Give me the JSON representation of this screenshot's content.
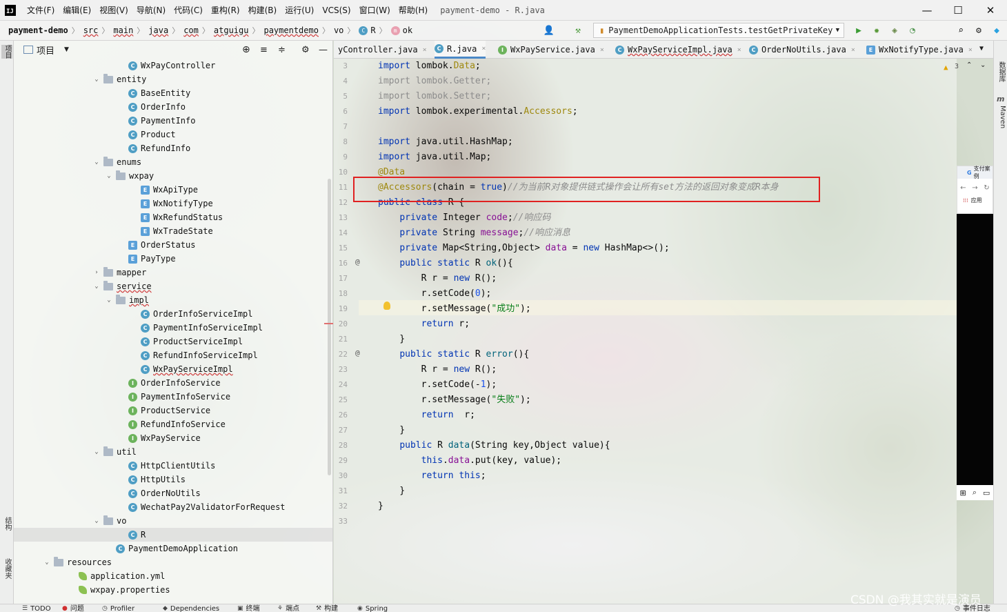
{
  "app": {
    "logo_text": "IJ",
    "window_title": "payment-demo - R.java",
    "menus": [
      "文件(F)",
      "编辑(E)",
      "视图(V)",
      "导航(N)",
      "代码(C)",
      "重构(R)",
      "构建(B)",
      "运行(U)",
      "VCS(S)",
      "窗口(W)",
      "帮助(H)"
    ],
    "controls": {
      "minimize": "—",
      "maximize": "☐",
      "close": "✕"
    }
  },
  "breadcrumb": [
    {
      "label": "payment-demo",
      "icon": ""
    },
    {
      "label": "src",
      "icon": ""
    },
    {
      "label": "main",
      "icon": ""
    },
    {
      "label": "java",
      "icon": ""
    },
    {
      "label": "com",
      "icon": ""
    },
    {
      "label": "atguigu",
      "icon": ""
    },
    {
      "label": "paymentdemo",
      "icon": ""
    },
    {
      "label": "vo",
      "icon": ""
    },
    {
      "label": "R",
      "icon": "C"
    },
    {
      "label": "ok",
      "icon": "m"
    }
  ],
  "run_config": "PaymentDemoApplicationTests.testGetPrivateKey",
  "left_stripe": {
    "project": "项目",
    "structure": "结构",
    "favorites": "收藏夹"
  },
  "right_stripe": {
    "database": "数据库",
    "maven": "Maven"
  },
  "project_panel": {
    "title": "项目"
  },
  "tree": [
    {
      "label": "WxPayController",
      "icon": "C",
      "arrow": ""
    },
    {
      "label": "entity",
      "icon": "folder",
      "arrow": "v"
    },
    {
      "label": "BaseEntity",
      "icon": "C",
      "arrow": ""
    },
    {
      "label": "OrderInfo",
      "icon": "C",
      "arrow": ""
    },
    {
      "label": "PaymentInfo",
      "icon": "C",
      "arrow": ""
    },
    {
      "label": "Product",
      "icon": "C",
      "arrow": ""
    },
    {
      "label": "RefundInfo",
      "icon": "C",
      "arrow": ""
    },
    {
      "label": "enums",
      "icon": "folder",
      "arrow": "v"
    },
    {
      "label": "wxpay",
      "icon": "folder",
      "arrow": "v"
    },
    {
      "label": "WxApiType",
      "icon": "E",
      "arrow": ""
    },
    {
      "label": "WxNotifyType",
      "icon": "E",
      "arrow": ""
    },
    {
      "label": "WxRefundStatus",
      "icon": "E",
      "arrow": ""
    },
    {
      "label": "WxTradeState",
      "icon": "E",
      "arrow": ""
    },
    {
      "label": "OrderStatus",
      "icon": "E",
      "arrow": ""
    },
    {
      "label": "PayType",
      "icon": "E",
      "arrow": ""
    },
    {
      "label": "mapper",
      "icon": "folder",
      "arrow": ">"
    },
    {
      "label": "service",
      "icon": "folder",
      "arrow": "v"
    },
    {
      "label": "impl",
      "icon": "folder",
      "arrow": "v"
    },
    {
      "label": "OrderInfoServiceImpl",
      "icon": "C",
      "arrow": ""
    },
    {
      "label": "PaymentInfoServiceImpl",
      "icon": "C",
      "arrow": ""
    },
    {
      "label": "ProductServiceImpl",
      "icon": "C",
      "arrow": ""
    },
    {
      "label": "RefundInfoServiceImpl",
      "icon": "C",
      "arrow": ""
    },
    {
      "label": "WxPayServiceImpl",
      "icon": "C",
      "arrow": ""
    },
    {
      "label": "OrderInfoService",
      "icon": "I",
      "arrow": ""
    },
    {
      "label": "PaymentInfoService",
      "icon": "I",
      "arrow": ""
    },
    {
      "label": "ProductService",
      "icon": "I",
      "arrow": ""
    },
    {
      "label": "RefundInfoService",
      "icon": "I",
      "arrow": ""
    },
    {
      "label": "WxPayService",
      "icon": "I",
      "arrow": ""
    },
    {
      "label": "util",
      "icon": "folder",
      "arrow": "v"
    },
    {
      "label": "HttpClientUtils",
      "icon": "C",
      "arrow": ""
    },
    {
      "label": "HttpUtils",
      "icon": "C",
      "arrow": ""
    },
    {
      "label": "OrderNoUtils",
      "icon": "C",
      "arrow": ""
    },
    {
      "label": "WechatPay2ValidatorForRequest",
      "icon": "C",
      "arrow": ""
    },
    {
      "label": "vo",
      "icon": "folder",
      "arrow": "v"
    },
    {
      "label": "R",
      "icon": "C",
      "arrow": ""
    },
    {
      "label": "PaymentDemoApplication",
      "icon": "C",
      "arrow": ""
    },
    {
      "label": "resources",
      "icon": "folder",
      "arrow": "v"
    },
    {
      "label": "application.yml",
      "icon": "leaf",
      "arrow": ""
    },
    {
      "label": "wxpay.properties",
      "icon": "leaf",
      "arrow": ""
    }
  ],
  "editor_tabs": [
    {
      "label": "yController.java",
      "icon": ""
    },
    {
      "label": "R.java",
      "icon": "C"
    },
    {
      "label": "WxPayService.java",
      "icon": "I"
    },
    {
      "label": "WxPayServiceImpl.java",
      "icon": "C"
    },
    {
      "label": "OrderNoUtils.java",
      "icon": "C"
    },
    {
      "label": "WxNotifyType.java",
      "icon": "E"
    }
  ],
  "warnings_count": "3",
  "code": {
    "line_numbers": [
      "3",
      "4",
      "5",
      "6",
      "7",
      "8",
      "9",
      "10",
      "11",
      "12",
      "13",
      "14",
      "15",
      "16",
      "17",
      "18",
      "19",
      "20",
      "21",
      "22",
      "23",
      "24",
      "25",
      "26",
      "27",
      "28",
      "29",
      "30",
      "31",
      "32",
      "33"
    ],
    "lines": [
      [
        {
          "t": "kw",
          "v": "import "
        },
        {
          "t": "plain",
          "v": "lombok."
        },
        {
          "t": "ann",
          "v": "Data"
        },
        {
          "t": "plain",
          "v": ";"
        }
      ],
      [
        {
          "t": "gray",
          "v": "import lombok.Getter;"
        }
      ],
      [
        {
          "t": "gray",
          "v": "import lombok.Setter;"
        }
      ],
      [
        {
          "t": "kw",
          "v": "import "
        },
        {
          "t": "plain",
          "v": "lombok.experimental."
        },
        {
          "t": "ann",
          "v": "Accessors"
        },
        {
          "t": "plain",
          "v": ";"
        }
      ],
      [],
      [
        {
          "t": "kw",
          "v": "import "
        },
        {
          "t": "plain",
          "v": "java.util.HashMap;"
        }
      ],
      [
        {
          "t": "kw",
          "v": "import "
        },
        {
          "t": "plain",
          "v": "java.util.Map;"
        }
      ],
      [
        {
          "t": "ann",
          "v": "@Data"
        }
      ],
      [
        {
          "t": "ann",
          "v": "@Accessors"
        },
        {
          "t": "plain",
          "v": "(chain = "
        },
        {
          "t": "kw",
          "v": "true"
        },
        {
          "t": "plain",
          "v": ")"
        },
        {
          "t": "cmt",
          "v": "//为当前R对象提供链式操作会让所有set方法的返回对象变成R本身"
        }
      ],
      [
        {
          "t": "kw",
          "v": "public class "
        },
        {
          "t": "plain",
          "v": "R {"
        }
      ],
      [
        {
          "t": "plain",
          "v": "    "
        },
        {
          "t": "kw",
          "v": "private "
        },
        {
          "t": "plain",
          "v": "Integer "
        },
        {
          "t": "field",
          "v": "code"
        },
        {
          "t": "plain",
          "v": ";"
        },
        {
          "t": "cmt",
          "v": "//响应码"
        }
      ],
      [
        {
          "t": "plain",
          "v": "    "
        },
        {
          "t": "kw",
          "v": "private "
        },
        {
          "t": "plain",
          "v": "String "
        },
        {
          "t": "field",
          "v": "message"
        },
        {
          "t": "plain",
          "v": ";"
        },
        {
          "t": "cmt",
          "v": "//响应消息"
        }
      ],
      [
        {
          "t": "plain",
          "v": "    "
        },
        {
          "t": "kw",
          "v": "private "
        },
        {
          "t": "plain",
          "v": "Map<String,Object> "
        },
        {
          "t": "field",
          "v": "data"
        },
        {
          "t": "plain",
          "v": " = "
        },
        {
          "t": "kw",
          "v": "new "
        },
        {
          "t": "plain",
          "v": "HashMap<>();"
        }
      ],
      [
        {
          "t": "plain",
          "v": "    "
        },
        {
          "t": "kw",
          "v": "public static "
        },
        {
          "t": "plain",
          "v": "R "
        },
        {
          "t": "fn",
          "v": "ok"
        },
        {
          "t": "plain",
          "v": "(){"
        }
      ],
      [
        {
          "t": "plain",
          "v": "        R r = "
        },
        {
          "t": "kw",
          "v": "new "
        },
        {
          "t": "plain",
          "v": "R();"
        }
      ],
      [
        {
          "t": "plain",
          "v": "        r.setCode("
        },
        {
          "t": "num",
          "v": "0"
        },
        {
          "t": "plain",
          "v": ");"
        }
      ],
      [
        {
          "t": "plain",
          "v": "        r.setMessage("
        },
        {
          "t": "str",
          "v": "\"成功\""
        },
        {
          "t": "plain",
          "v": ");"
        }
      ],
      [
        {
          "t": "plain",
          "v": "        "
        },
        {
          "t": "kw",
          "v": "return "
        },
        {
          "t": "plain",
          "v": "r;"
        }
      ],
      [
        {
          "t": "plain",
          "v": "    }"
        }
      ],
      [
        {
          "t": "plain",
          "v": "    "
        },
        {
          "t": "kw",
          "v": "public static "
        },
        {
          "t": "plain",
          "v": "R "
        },
        {
          "t": "fn",
          "v": "error"
        },
        {
          "t": "plain",
          "v": "(){"
        }
      ],
      [
        {
          "t": "plain",
          "v": "        R r = "
        },
        {
          "t": "kw",
          "v": "new "
        },
        {
          "t": "plain",
          "v": "R();"
        }
      ],
      [
        {
          "t": "plain",
          "v": "        r.setCode(-"
        },
        {
          "t": "num",
          "v": "1"
        },
        {
          "t": "plain",
          "v": ");"
        }
      ],
      [
        {
          "t": "plain",
          "v": "        r.setMessage("
        },
        {
          "t": "str",
          "v": "\"失败\""
        },
        {
          "t": "plain",
          "v": ");"
        }
      ],
      [
        {
          "t": "plain",
          "v": "        "
        },
        {
          "t": "kw",
          "v": "return  "
        },
        {
          "t": "plain",
          "v": "r;"
        }
      ],
      [
        {
          "t": "plain",
          "v": "    }"
        }
      ],
      [
        {
          "t": "plain",
          "v": "    "
        },
        {
          "t": "kw",
          "v": "public "
        },
        {
          "t": "plain",
          "v": "R "
        },
        {
          "t": "fn",
          "v": "data"
        },
        {
          "t": "plain",
          "v": "(String key,Object value){"
        }
      ],
      [
        {
          "t": "plain",
          "v": "        "
        },
        {
          "t": "kw",
          "v": "this"
        },
        {
          "t": "plain",
          "v": "."
        },
        {
          "t": "field",
          "v": "data"
        },
        {
          "t": "plain",
          "v": ".put(key, value);"
        }
      ],
      [
        {
          "t": "plain",
          "v": "        "
        },
        {
          "t": "kw",
          "v": "return this"
        },
        {
          "t": "plain",
          "v": ";"
        }
      ],
      [
        {
          "t": "plain",
          "v": "    }"
        }
      ],
      [
        {
          "t": "plain",
          "v": "}"
        }
      ],
      []
    ]
  },
  "browser_popup": {
    "tab": "支付案例",
    "apps": "应用"
  },
  "bottom_tools": [
    "TODO",
    "问题",
    "Profiler",
    "Dependencies",
    "终端",
    "端点",
    "构建",
    "Spring"
  ],
  "event_log": "事件日志",
  "watermark": "CSDN @我其实就是演员",
  "colors": {
    "accent": "#4a88c7",
    "highlight_box": "#e02020",
    "keyword": "#0033b3",
    "annotation": "#9e880d",
    "field": "#871094",
    "string": "#067d17"
  }
}
